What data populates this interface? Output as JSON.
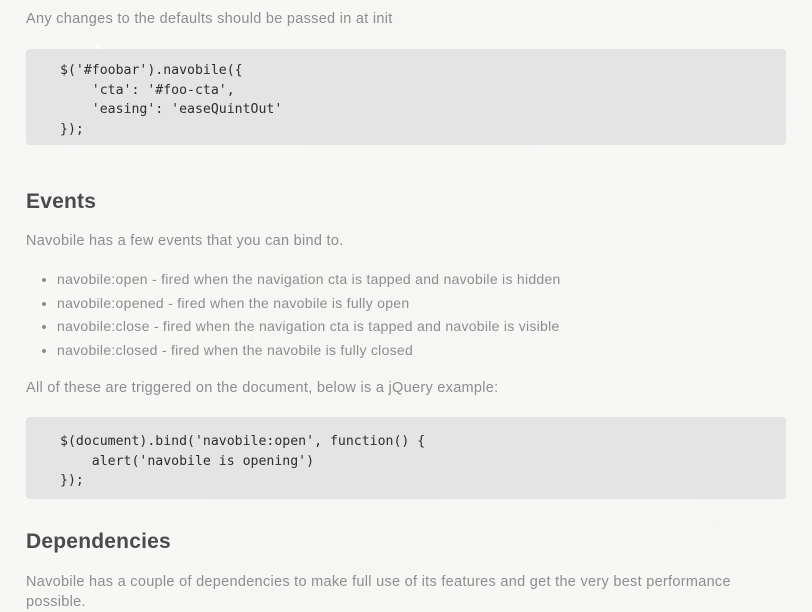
{
  "intro": {
    "text": "Any changes to the defaults should be passed in at init"
  },
  "code_init": {
    "line1": "$('#foobar').navobile({",
    "line2": "    'cta': '#foo-cta',",
    "line3": "    'easing': 'easeQuintOut'",
    "line4": "});"
  },
  "events_section": {
    "heading": "Events",
    "intro": "Navobile has a few events that you can bind to.",
    "items": [
      "navobile:open - fired when the navigation cta is tapped and navobile is hidden",
      "navobile:opened - fired when the navobile is fully open",
      "navobile:close - fired when the navigation cta is tapped and navobile is visible",
      "navobile:closed - fired when the navobile is fully closed"
    ],
    "trigger_note": "All of these are triggered on the document, below is a jQuery example:"
  },
  "code_bind": {
    "line1": "$(document).bind('navobile:open', function() {",
    "line2": "    alert('navobile is opening')",
    "line3": "});"
  },
  "dependencies_section": {
    "heading": "Dependencies",
    "intro": "Navobile has a couple of dependencies to make full use of its features and get the very best performance possible."
  },
  "colors": {
    "page_background": "#f7f7f6",
    "code_background": "#e4e4e4",
    "heading_text": "#4b4b4b",
    "body_text": "#8d8d8d",
    "code_text": "#2e2e2e"
  }
}
